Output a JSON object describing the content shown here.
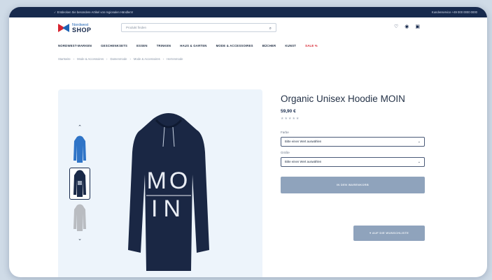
{
  "topbar": {
    "left": "✓ Entdecken Sie besondere Artikel von regionalen Händlern!",
    "right": "Kundenservice +49 000 0000 0000"
  },
  "header": {
    "logo_line1": "Nordwest",
    "logo_line2": "SHOP",
    "search_placeholder": "Produkt finden",
    "icons": [
      "heart-icon",
      "user-icon",
      "cart-icon"
    ]
  },
  "nav": {
    "items": [
      "NORDWEST-MARKEN",
      "GESCHENKSETS",
      "ESSEN",
      "TRINKEN",
      "HAUS & GARTEN",
      "MODE & ACCESSOIRES",
      "BÜCHER",
      "KUNST",
      "SALE %"
    ]
  },
  "breadcrumb": [
    "Startseite",
    "Mode & Accessoires",
    "Damenmode",
    "Mode & Accessoires",
    "Herrenmode"
  ],
  "product": {
    "title": "Organic Unisex Hoodie MOIN",
    "price": "59,90 €",
    "stars": "★★★★★",
    "print_top": "MO",
    "print_bottom": "IN",
    "color_label": "Farbe",
    "color_value": "Bitte einen Wert auswählen",
    "size_label": "Größe",
    "size_value": "Bitte einen Wert auswählen",
    "cart_button": "IN DEN WARENKORB",
    "wishlist_button": "♥  AUF DIE WUNSCHLISTE"
  },
  "colors": {
    "navy": "#172a4d",
    "accent_red": "#d7232f",
    "brand_blue": "#1e63b5",
    "button_disabled": "#8fa3bc",
    "gallery_bg": "#edf4fb"
  }
}
